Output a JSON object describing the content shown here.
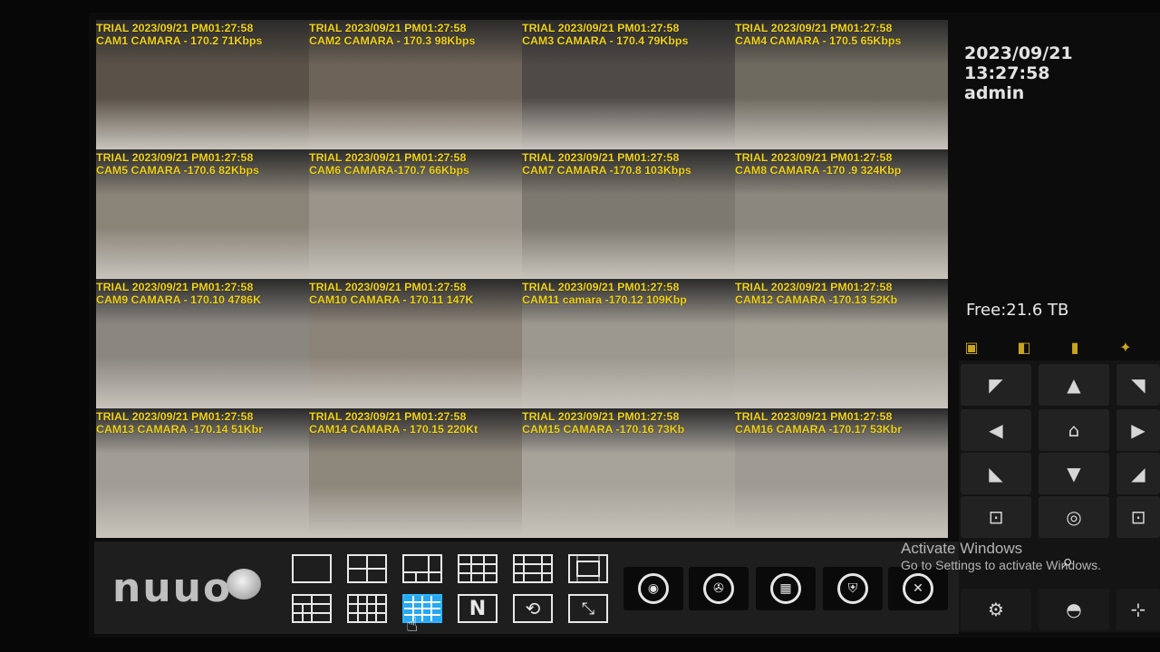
{
  "app": {
    "brand": "nuuo"
  },
  "status": {
    "date": "2023/09/21",
    "time": "13:27:58",
    "user": "admin",
    "free_space": "Free:21.6 TB"
  },
  "cameras": [
    {
      "line1": "TRIAL 2023/09/21 PM01:27:58",
      "line2": "CAM1 CAMARA - 170.2 71Kbps"
    },
    {
      "line1": "TRIAL 2023/09/21 PM01:27:58",
      "line2": "CAM2 CAMARA - 170.3 98Kbps"
    },
    {
      "line1": "TRIAL 2023/09/21 PM01:27:58",
      "line2": "CAM3 CAMARA - 170.4 79Kbps"
    },
    {
      "line1": "TRIAL 2023/09/21 PM01:27:58",
      "line2": "CAM4 CAMARA - 170.5 65Kbps"
    },
    {
      "line1": "TRIAL 2023/09/21 PM01:27:58",
      "line2": "CAM5 CAMARA -170.6 82Kbps"
    },
    {
      "line1": "TRIAL 2023/09/21 PM01:27:58",
      "line2": "CAM6 CAMARA-170.7 66Kbps"
    },
    {
      "line1": "TRIAL 2023/09/21 PM01:27:58",
      "line2": "CAM7 CAMARA -170.8 103Kbps"
    },
    {
      "line1": "TRIAL 2023/09/21 PM01:27:58",
      "line2": "CAM8 CAMARA -170 .9 324Kbp"
    },
    {
      "line1": "TRIAL 2023/09/21 PM01:27:58",
      "line2": "CAM9 CAMARA - 170.10 4786K"
    },
    {
      "line1": "TRIAL 2023/09/21 PM01:27:58",
      "line2": "CAM10 CAMARA - 170.11 147K"
    },
    {
      "line1": "TRIAL 2023/09/21 PM01:27:58",
      "line2": "CAM11 camara -170.12 109Kbp"
    },
    {
      "line1": "TRIAL 2023/09/21 PM01:27:58",
      "line2": "CAM12 CAMARA -170.13 52Kb"
    },
    {
      "line1": "TRIAL 2023/09/21 PM01:27:58",
      "line2": "CAM13 CAMARA -170.14 51Kbr"
    },
    {
      "line1": "TRIAL 2023/09/21 PM01:27:58",
      "line2": "CAM14 CAMARA - 170.15 220Kt"
    },
    {
      "line1": "TRIAL 2023/09/21 PM01:27:58",
      "line2": "CAM15 CAMARA -170.16 73Kb"
    },
    {
      "line1": "TRIAL 2023/09/21 PM01:27:58",
      "line2": "CAM16 CAMARA -170.17 53Kbr"
    }
  ],
  "scene_tones": [
    "#5a5248",
    "#6e6358",
    "#4e4a48",
    "#6f6a60",
    "#8a8378",
    "#9a948a",
    "#7e7970",
    "#8c877e",
    "#8a8680",
    "#8c8378",
    "#9d988f",
    "#a39e94",
    "#a19d96",
    "#8e877c",
    "#a7a39b",
    "#9f9b94"
  ],
  "layout_buttons": [
    "layout-1",
    "layout-4",
    "layout-6",
    "layout-9",
    "layout-10",
    "layout-13",
    "layout-8",
    "layout-16-alt",
    "layout-16",
    "layout-N",
    "layout-rotate",
    "layout-fullscreen"
  ],
  "function_buttons": [
    "record-icon",
    "playback-icon",
    "schedule-icon",
    "security-icon",
    "settings-tools-icon"
  ],
  "layout_N_label": "N",
  "watermark": {
    "line1": "Activate Windows",
    "line2": "Go to Settings to activate Windows."
  },
  "colors": {
    "caption": "#f2d41a",
    "selected_layout": "#27a8f0"
  }
}
